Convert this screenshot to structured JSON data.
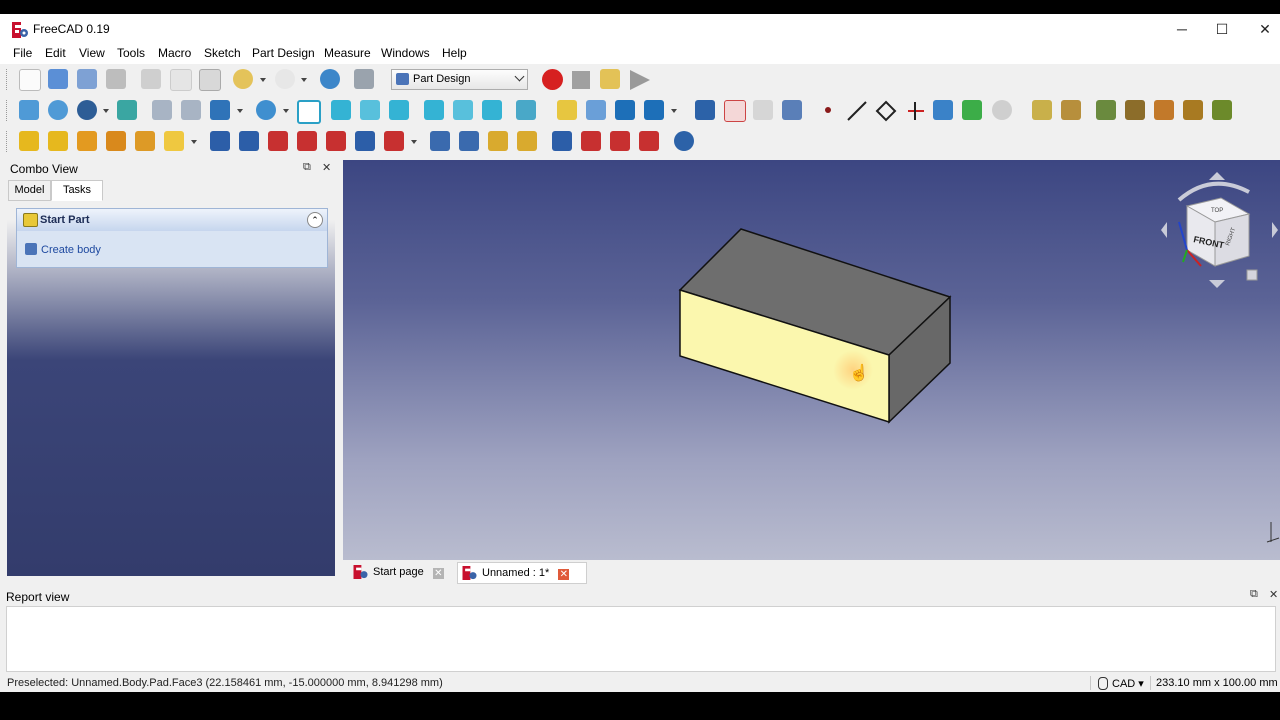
{
  "window": {
    "title": "FreeCAD 0.19",
    "minimize": "─",
    "maximize": "☐",
    "close": "✕"
  },
  "menu": [
    "File",
    "Edit",
    "View",
    "Tools",
    "Macro",
    "Sketch",
    "Part Design",
    "Measure",
    "Windows",
    "Help"
  ],
  "workbench": {
    "selected": "Part Design"
  },
  "combo_view": {
    "title": "Combo View",
    "float_button": "⧉",
    "close_button": "✕",
    "tabs": [
      "Model",
      "Tasks"
    ],
    "active_tab": "Tasks",
    "task_panel": {
      "title": "Start Part",
      "collapse": "⌃",
      "action": "Create body"
    }
  },
  "navcube": {
    "front_label": "FRONT",
    "top_label": "TOP",
    "right_label": "RIGHT"
  },
  "doc_tabs": [
    {
      "label": "Start page",
      "close": "✕"
    },
    {
      "label": "Unnamed : 1*",
      "close": "✕"
    }
  ],
  "report_view": {
    "title": "Report view",
    "float_button": "⧉",
    "close_button": "✕"
  },
  "status_bar": {
    "text": "Preselected: Unnamed.Body.Pad.Face3 (22.158461 mm, -15.000000 mm, 8.941298 mm)",
    "nav_style": "CAD ▾",
    "dimensions": "233.10 mm x 100.00 mm"
  },
  "cursor": {
    "glyph": "☝"
  },
  "colors": {
    "selected_face": "#fbf7ae",
    "body_faces": "#6e6e6e",
    "viewport_top": "#3c4682",
    "viewport_bottom": "#b9bccf",
    "accent_red": "#d62020"
  },
  "toolbar_icons": {
    "row1": [
      "new-icon",
      "open-icon",
      "save-icon",
      "print-icon",
      "cut-icon",
      "copy-icon",
      "paste-icon",
      "undo-icon",
      "redo-icon",
      "refresh-icon",
      "whats-this-icon",
      "record-macro-icon",
      "stop-macro-icon",
      "edit-macro-icon",
      "run-macro-icon"
    ],
    "row2": [
      "fit-all-icon",
      "fit-selection-icon",
      "draw-style-icon",
      "bounding-box-icon",
      "back-icon",
      "forward-icon",
      "sync-view-icon",
      "zoom-icon",
      "isometric-icon",
      "front-view-icon",
      "top-view-icon",
      "right-view-icon",
      "rear-view-icon",
      "bottom-view-icon",
      "left-view-icon",
      "measure-icon",
      "part-icon",
      "group-icon",
      "link-icon",
      "link-actions-icon",
      "create-body-icon",
      "create-sketch-icon",
      "validate-sketch-icon",
      "check-geometry-icon",
      "datum-point-icon",
      "datum-line-icon",
      "datum-plane-icon",
      "local-cs-icon",
      "shape-binder-icon",
      "subshape-binder-icon",
      "clone-icon",
      "measure-linear-icon",
      "measure-angular-icon",
      "measure-refresh-icon",
      "measure-clear-icon",
      "measure-toggle-all-icon",
      "measure-toggle-3d-icon",
      "measure-toggle-delta-icon"
    ],
    "row3": [
      "pad-icon",
      "revolution-icon",
      "additive-loft-icon",
      "additive-pipe-icon",
      "additive-helix-icon",
      "additive-primitive-icon",
      "pocket-icon",
      "hole-icon",
      "groove-icon",
      "subtractive-loft-icon",
      "subtractive-pipe-icon",
      "subtractive-helix-icon",
      "subtractive-primitive-icon",
      "mirrored-icon",
      "linear-pattern-icon",
      "polar-pattern-icon",
      "multi-transform-icon",
      "fillet-icon",
      "chamfer-icon",
      "draft-icon",
      "thickness-icon",
      "boolean-icon"
    ]
  }
}
